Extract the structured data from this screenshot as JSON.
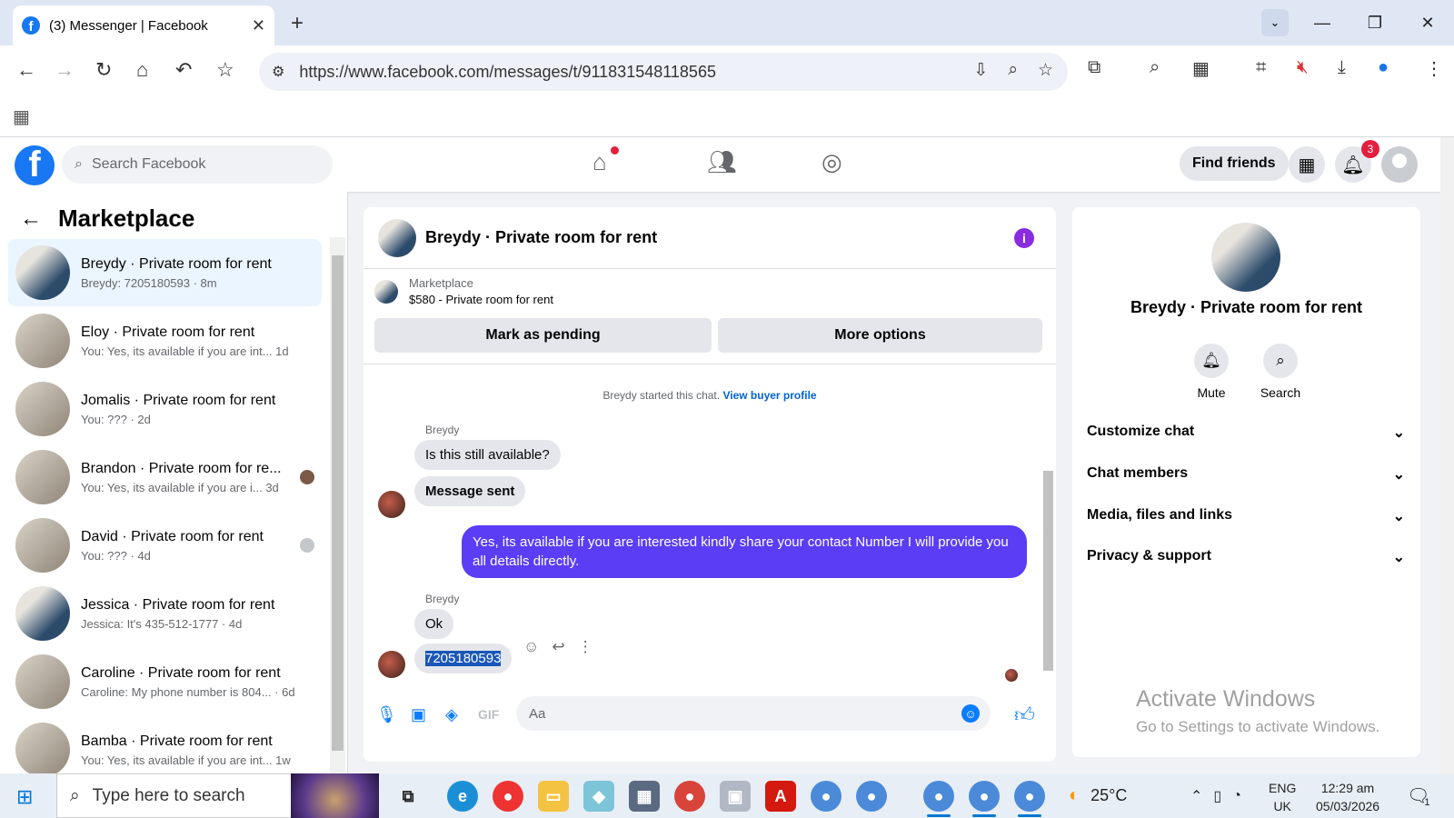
{
  "browser": {
    "tab_title": "(3) Messenger | Facebook",
    "url": "https://www.facebook.com/messages/t/911831548118565"
  },
  "fb": {
    "search_placeholder": "Search Facebook",
    "find_friends": "Find friends",
    "notif_count": "3"
  },
  "left": {
    "title": "Marketplace",
    "conversations": [
      {
        "name": "Breydy · Private room for rent",
        "preview": "Breydy: 7205180593 · 8m"
      },
      {
        "name": "Eloy · Private room for rent",
        "preview": "You: Yes, its available if you are int...  1d"
      },
      {
        "name": "Jomalis · Private room for rent",
        "preview": "You: ??? · 2d"
      },
      {
        "name": "Brandon · Private room for re...",
        "preview": "You: Yes, its available if you are i...  3d"
      },
      {
        "name": "David · Private room for rent",
        "preview": "You: ??? · 4d"
      },
      {
        "name": "Jessica · Private room for rent",
        "preview": "Jessica: It's 435-512-1777 · 4d"
      },
      {
        "name": "Caroline · Private room for rent",
        "preview": "Caroline: My phone number is 804... · 6d"
      },
      {
        "name": "Bamba · Private room for rent",
        "preview": "You: Yes, its available if you are int...  1w"
      }
    ]
  },
  "chat": {
    "title": "Breydy · Private room for rent",
    "listing_label": "Marketplace",
    "listing_detail": "$580 - Private room for rent",
    "mark_pending": "Mark as pending",
    "more_options": "More options",
    "system_text": "Breydy started this chat.",
    "system_link": "View buyer profile",
    "sender": "Breydy",
    "msg1": "Is this still available?",
    "msg2": "Message sent",
    "msg3": "Yes, its available if you are interested kindly share your contact Number I will provide you all details directly.",
    "msg4": "Ok",
    "msg5": "7205180593",
    "composer_placeholder": "Aa"
  },
  "right": {
    "title": "Breydy · Private room for rent",
    "mute": "Mute",
    "search": "Search",
    "rows": [
      "Customize chat",
      "Chat members",
      "Media, files and links",
      "Privacy & support"
    ]
  },
  "watermark": {
    "line1": "Activate Windows",
    "line2": "Go to Settings to activate Windows."
  },
  "taskbar": {
    "search_placeholder": "Type here to search",
    "temperature": "25°C",
    "lang1": "ENG",
    "lang2": "UK",
    "time": "12:29 am",
    "date": "05/03/2026",
    "notif_count": "1"
  }
}
